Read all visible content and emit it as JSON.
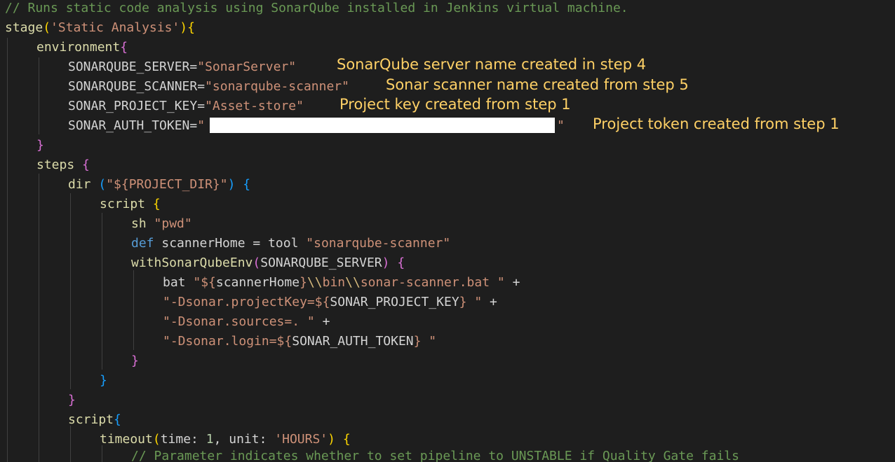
{
  "code": {
    "comment1": "// Runs static code analysis using SonarQube installed in Jenkins virtual machine.",
    "stage_fn": "stage",
    "stage_open": "(",
    "stage_name": "'Static Analysis'",
    "stage_close": ")",
    "brace_open": "{",
    "brace_close": "}",
    "environment": "environment",
    "env": {
      "server_key": "SONARQUBE_SERVER",
      "server_val": "\"SonarServer\"",
      "scanner_key": "SONARQUBE_SCANNER",
      "scanner_val": "\"sonarqube-scanner\"",
      "project_key": "SONAR_PROJECT_KEY",
      "project_val": "\"Asset-store\"",
      "token_key": "SONAR_AUTH_TOKEN",
      "token_open": "\"",
      "token_close": "\"",
      "equals": "="
    },
    "steps": "steps",
    "dir_fn": "dir",
    "dir_arg": "\"${PROJECT_DIR}\"",
    "script": "script",
    "sh_fn": "sh",
    "sh_arg": "\"pwd\"",
    "def_kw": "def",
    "scanner_home": "scannerHome",
    "assign": " = ",
    "tool_fn": "tool",
    "tool_arg": "\"sonarqube-scanner\"",
    "with_env": "withSonarQubeEnv",
    "with_env_arg": "SONARQUBE_SERVER",
    "bat_fn": "bat",
    "bat_str1": "\"${",
    "bat_var": "scannerHome",
    "bat_str2": "}",
    "bat_esc1": "\\\\",
    "bat_bin": "bin",
    "bat_esc2": "\\\\",
    "bat_rest": "sonar-scanner.bat \"",
    "plus": " +",
    "dproj_str": "\"-Dsonar.projectKey=${",
    "dproj_var": "SONAR_PROJECT_KEY",
    "dproj_end": "} \"",
    "dsrc_str": "\"-Dsonar.sources=. \"",
    "dlogin_str": "\"-Dsonar.login=${",
    "dlogin_var": "SONAR_AUTH_TOKEN",
    "dlogin_end": "} \"",
    "timeout_fn": "timeout",
    "timeout_time_label": "time: ",
    "timeout_time": "1",
    "timeout_unit_label": ", unit: ",
    "timeout_unit": "'HOURS'",
    "comment2": "// Parameter indicates whether to set pipeline to UNSTABLE if Quality Gate fails"
  },
  "notes": {
    "server": "SonarQube server name created in step 4",
    "scanner": "Sonar scanner name created from step 5",
    "project": "Project key created from step 1",
    "token": "Project token created from step 1"
  },
  "colors": {
    "background": "#1e1e1e",
    "annotation": "#ffd166",
    "redaction": "#ffffff"
  }
}
